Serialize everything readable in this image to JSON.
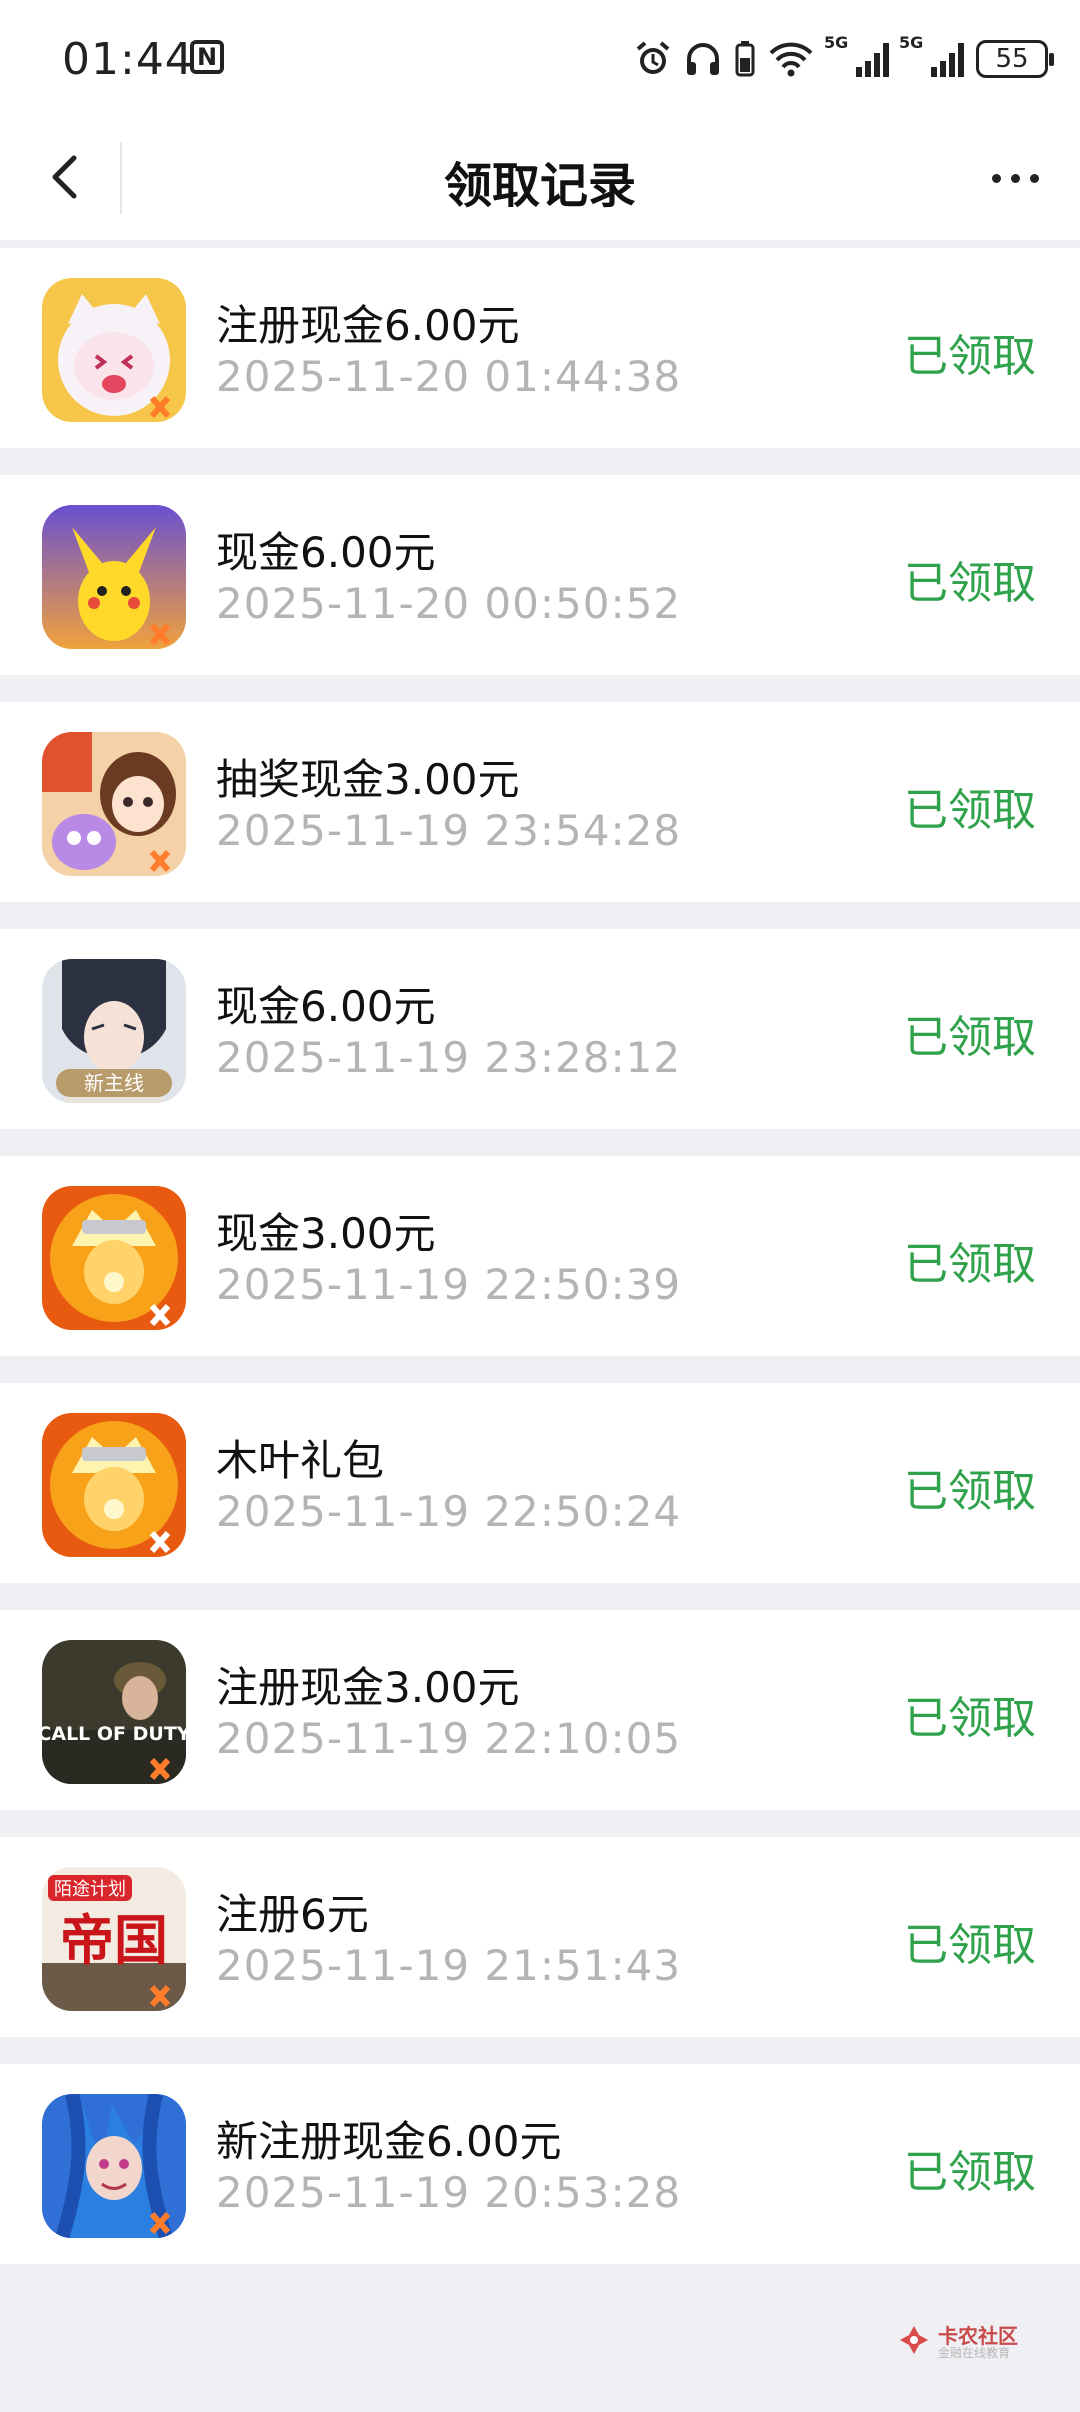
{
  "status_bar": {
    "time": "01:44",
    "nfc_label": "N",
    "battery": "55",
    "net1": "5G",
    "net2": "5G"
  },
  "nav": {
    "title": "领取记录"
  },
  "records": [
    {
      "name": "注册现金6.00元",
      "date": "2025-11-20 01:44:38",
      "status": "已领取",
      "icon": "cat-game-icon"
    },
    {
      "name": "现金6.00元",
      "date": "2025-11-20 00:50:52",
      "status": "已领取",
      "icon": "pikachu-game-icon"
    },
    {
      "name": "抽奖现金3.00元",
      "date": "2025-11-19 23:54:28",
      "status": "已领取",
      "icon": "cute-characters-game-icon"
    },
    {
      "name": "现金6.00元",
      "date": "2025-11-19 23:28:12",
      "status": "已领取",
      "icon": "romance-game-icon",
      "icon_label": "新主线"
    },
    {
      "name": "现金3.00元",
      "date": "2025-11-19 22:50:39",
      "status": "已领取",
      "icon": "naruto-game-icon"
    },
    {
      "name": "木叶礼包",
      "date": "2025-11-19 22:50:24",
      "status": "已领取",
      "icon": "naruto-game-icon"
    },
    {
      "name": "注册现金3.00元",
      "date": "2025-11-19 22:10:05",
      "status": "已领取",
      "icon": "call-of-duty-game-icon",
      "icon_label": "CALL OF DUTY"
    },
    {
      "name": "注册6元",
      "date": "2025-11-19 21:51:43",
      "status": "已领取",
      "icon": "empire-game-icon",
      "icon_label": "帝国",
      "icon_sub": "陌途计划"
    },
    {
      "name": "新注册现金6.00元",
      "date": "2025-11-19 20:53:28",
      "status": "已领取",
      "icon": "jinx-game-icon"
    }
  ],
  "watermark": {
    "name": "卡农社区",
    "sub": "金融在线教育"
  },
  "colors": {
    "status_green": "#2fa24b",
    "date_grey": "#b4b4b4",
    "page_bg": "#efeff4"
  }
}
